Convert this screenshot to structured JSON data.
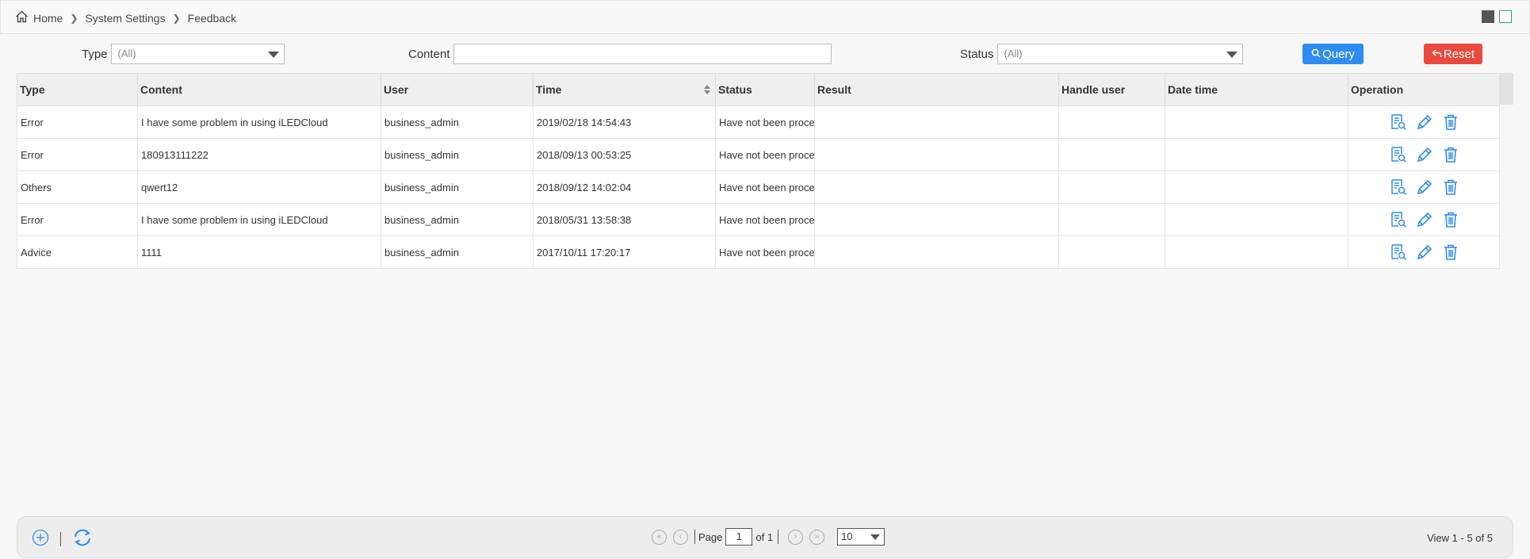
{
  "breadcrumb": {
    "home": "Home",
    "section": "System Settings",
    "page": "Feedback"
  },
  "filters": {
    "type_label": "Type",
    "type_value": "(All)",
    "content_label": "Content",
    "content_value": "",
    "status_label": "Status",
    "status_value": "(All)",
    "query_label": "Query",
    "reset_label": "Reset"
  },
  "table": {
    "columns": [
      "Type",
      "Content",
      "User",
      "Time",
      "Status",
      "Result",
      "Handle user",
      "Date time",
      "Operation"
    ],
    "rows": [
      {
        "type": "Error",
        "content": "I have some problem in using iLEDCloud",
        "user": "business_admin",
        "time": "2019/02/18 14:54:43",
        "status": "Have not been processed",
        "result": "",
        "handle_user": "",
        "date_time": ""
      },
      {
        "type": "Error",
        "content": "180913111222",
        "user": "business_admin",
        "time": "2018/09/13 00:53:25",
        "status": "Have not been processed",
        "result": "",
        "handle_user": "",
        "date_time": ""
      },
      {
        "type": "Others",
        "content": "qwert12",
        "user": "business_admin",
        "time": "2018/09/12 14:02:04",
        "status": "Have not been processed",
        "result": "",
        "handle_user": "",
        "date_time": ""
      },
      {
        "type": "Error",
        "content": "I have some problem in using iLEDCloud",
        "user": "business_admin",
        "time": "2018/05/31 13:58:38",
        "status": "Have not been processed",
        "result": "",
        "handle_user": "",
        "date_time": ""
      },
      {
        "type": "Advice",
        "content": "1111",
        "user": "business_admin",
        "time": "2017/10/11 17:20:17",
        "status": "Have not been processed",
        "result": "",
        "handle_user": "",
        "date_time": ""
      }
    ],
    "operation_icons": [
      "view-detail-icon",
      "edit-pencil-icon",
      "delete-trash-icon"
    ]
  },
  "pager": {
    "page_label": "Page",
    "page_value": "1",
    "of_label": "of 1",
    "page_size": "10",
    "view_info": "View 1 - 5 of 5"
  },
  "colors": {
    "query": "#2f8cf0",
    "reset": "#e84a3f",
    "icon_blue": "#2f8cf0"
  }
}
